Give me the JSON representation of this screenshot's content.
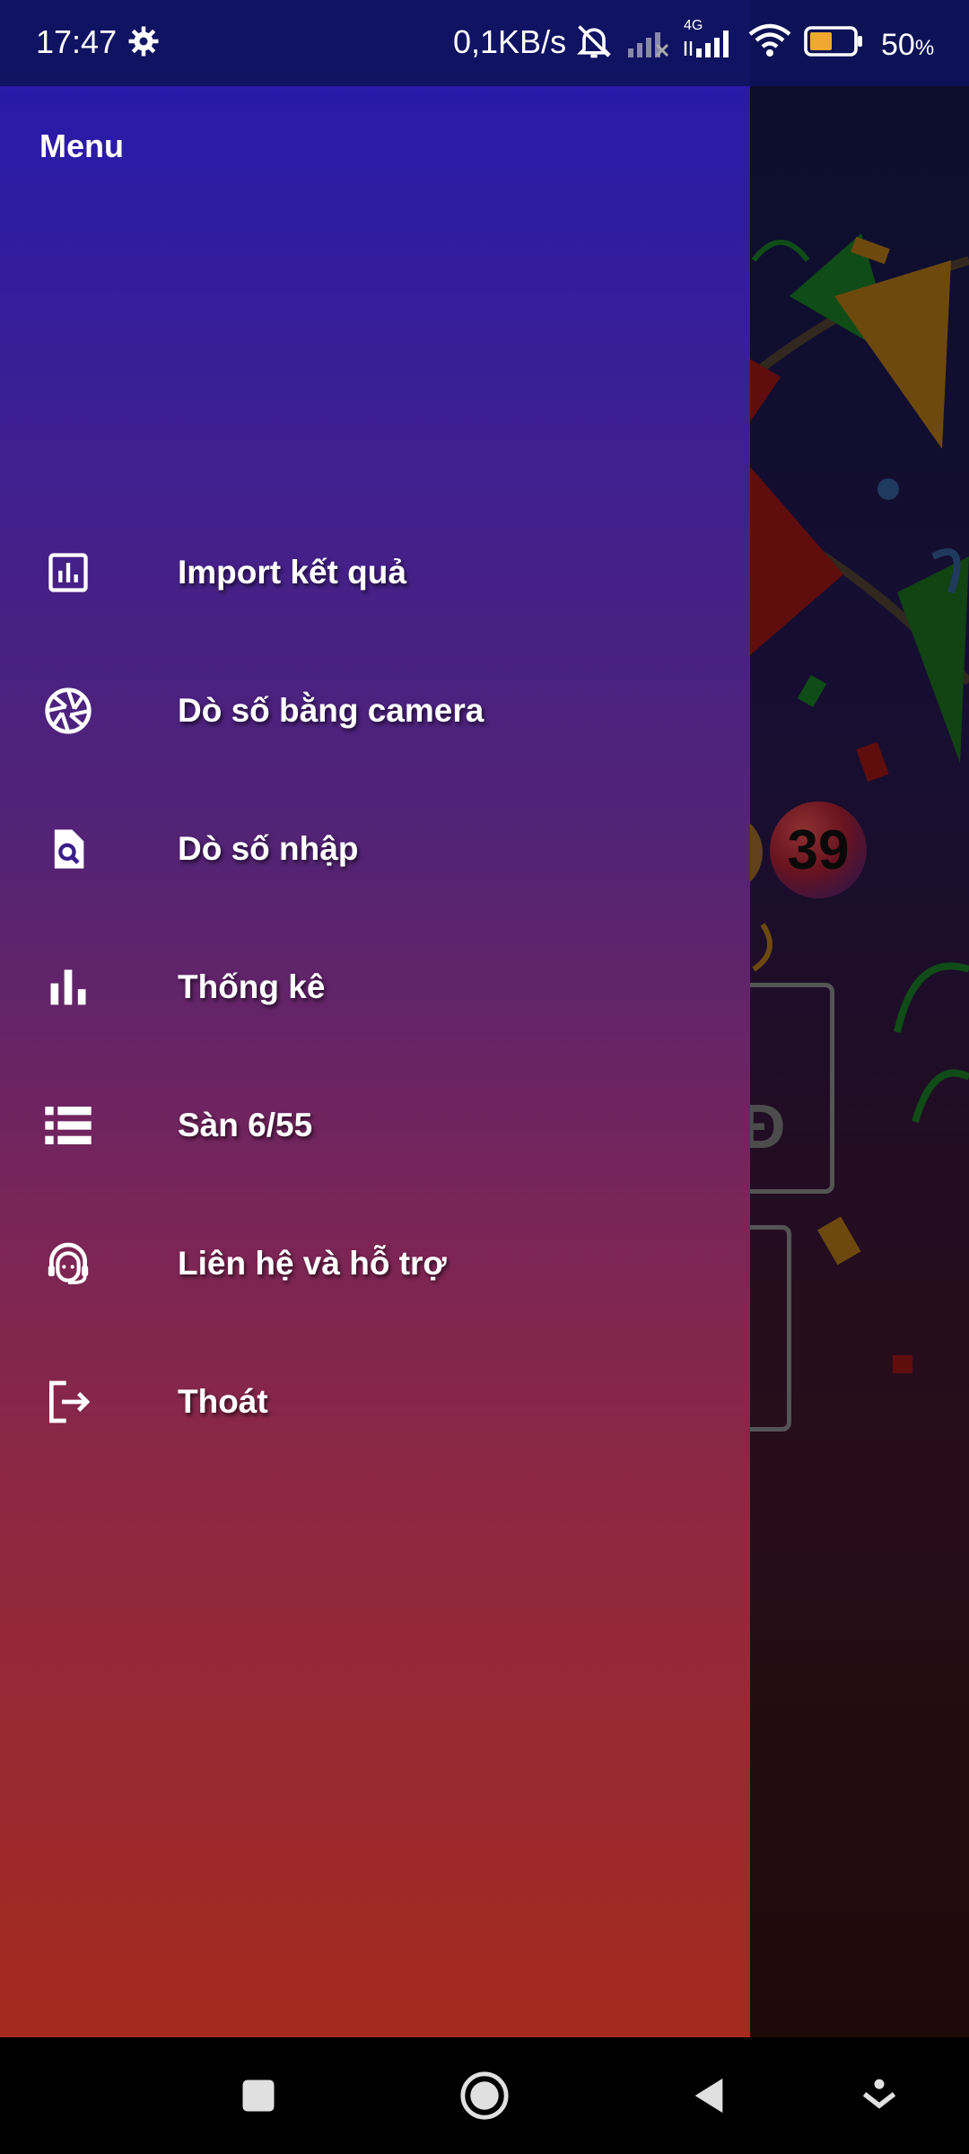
{
  "status_bar": {
    "time": "17:47",
    "network_speed": "0,1KB/s",
    "network_type": "4G",
    "battery_percent": "50",
    "battery_unit": "%",
    "icons": [
      "gear-icon",
      "mute-icon",
      "signal-icon",
      "wifi-icon",
      "battery-icon"
    ]
  },
  "drawer": {
    "title": "Menu",
    "items": [
      {
        "label": "Import kết quả",
        "icon": "report-icon"
      },
      {
        "label": "Dò số bằng camera",
        "icon": "camera-shutter-icon"
      },
      {
        "label": "Dò số nhập",
        "icon": "file-search-icon"
      },
      {
        "label": "Thống kê",
        "icon": "bar-chart-icon"
      },
      {
        "label": "Sàn 6/55",
        "icon": "list-icon"
      },
      {
        "label": "Liên hệ và hỗ trợ",
        "icon": "support-agent-icon"
      },
      {
        "label": "Thoát",
        "icon": "logout-icon"
      }
    ]
  },
  "background": {
    "ball_number": "39",
    "prize_text": "Đ"
  },
  "nav_bar": {
    "buttons": [
      "recents-button",
      "home-button",
      "back-button",
      "menu-down-button"
    ]
  }
}
